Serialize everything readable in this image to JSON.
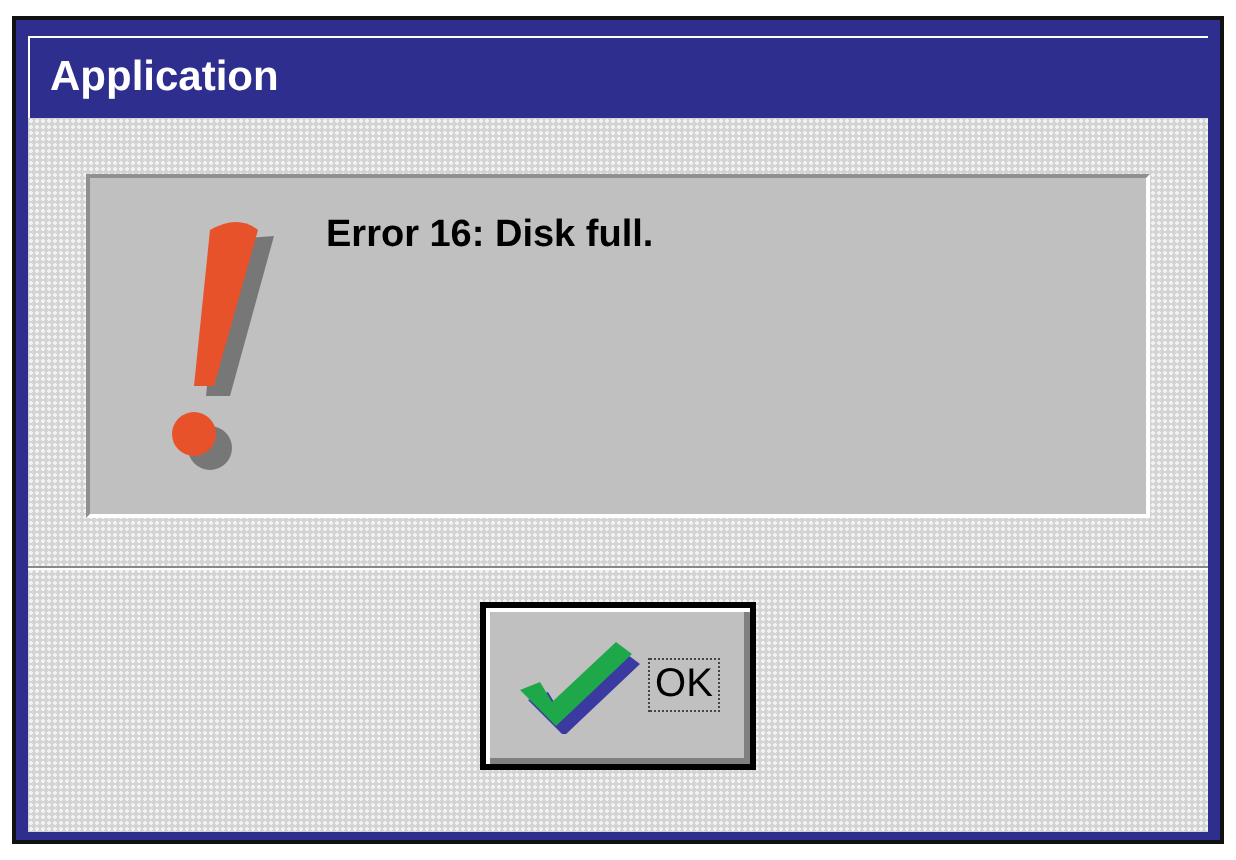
{
  "window": {
    "title": "Application"
  },
  "message": {
    "kind": "error",
    "text": "Error 16: Disk full."
  },
  "buttons": [
    {
      "label": "OK",
      "kind": "ok",
      "focused": true
    }
  ]
}
